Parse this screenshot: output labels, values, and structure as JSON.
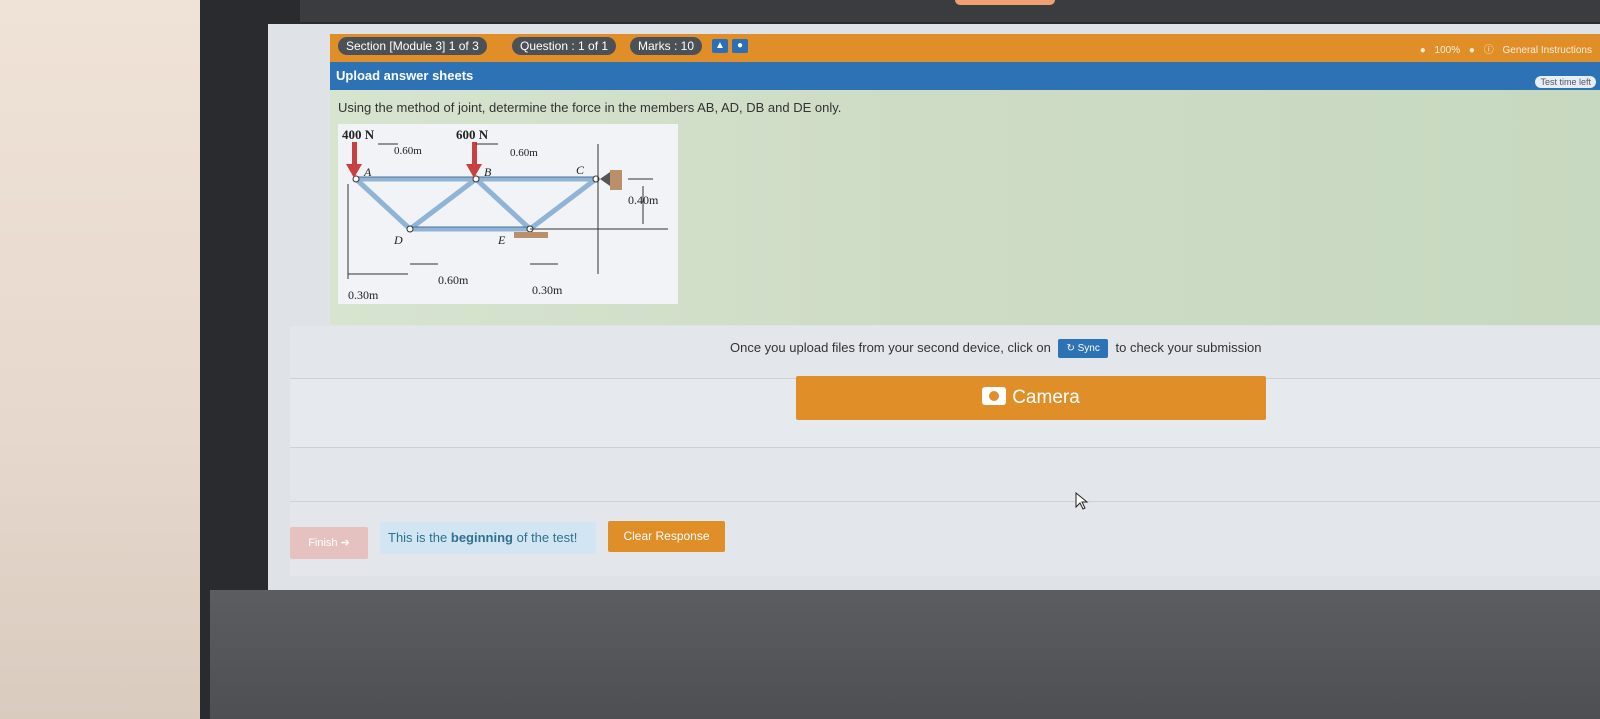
{
  "header": {
    "section": "Section [Module 3] 1 of 3",
    "question": "Question : 1 of 1",
    "marks": "Marks : 10",
    "zoom": "100%",
    "general_instructions": "General Instructions"
  },
  "subheader": {
    "title": "Upload answer sheets",
    "time_left": "Test time left"
  },
  "question": {
    "text": "Using the method of joint, determine the force in the members AB, AD, DB and DE only.",
    "figure": {
      "load_a": "400 N",
      "load_b": "600 N",
      "dim_top_left": "0.60m",
      "dim_top_right": "0.60m",
      "dim_height": "0.40m",
      "dim_bottom_left": "0.30m",
      "dim_bottom_mid": "0.60m",
      "dim_bottom_right": "0.30m",
      "node_a": "A",
      "node_b": "B",
      "node_c": "C",
      "node_d": "D",
      "node_e": "E"
    }
  },
  "upload": {
    "info_before": "Once you upload files from your second device, click on",
    "sync_label": "Sync",
    "info_after": "to check your submission",
    "camera_label": "Camera"
  },
  "footer": {
    "finish_label": "Finish",
    "begin_prefix": "This is the",
    "begin_bold": "beginning",
    "begin_suffix": "of the test!",
    "clear_label": "Clear Response"
  },
  "colors": {
    "orange": "#e08e28",
    "blue": "#2d72b5",
    "pill": "#4c5157"
  }
}
